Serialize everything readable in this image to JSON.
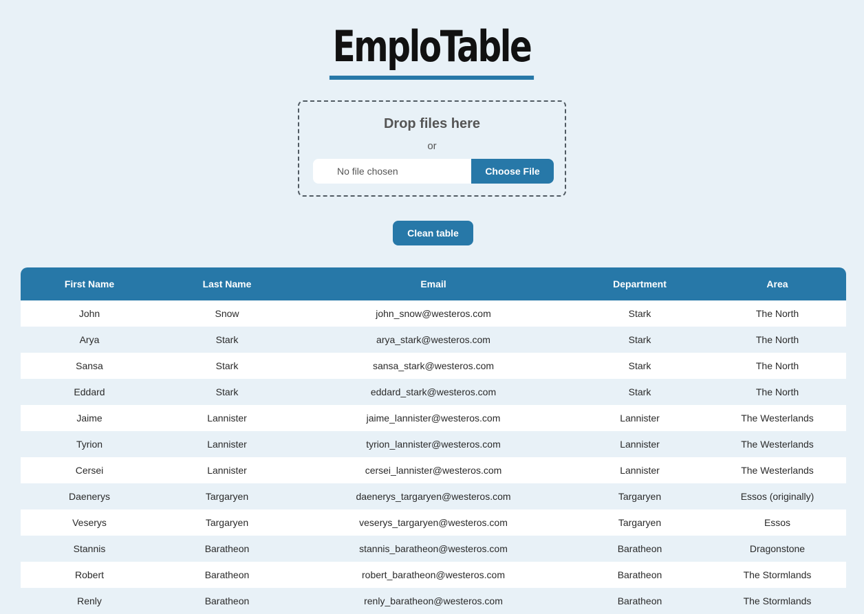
{
  "app": {
    "title": "EmploTable"
  },
  "upload": {
    "drop_title": "Drop files here",
    "or_text": "or",
    "file_status": "No file chosen",
    "choose_label": "Choose File"
  },
  "actions": {
    "clean_label": "Clean table"
  },
  "colors": {
    "accent": "#2778a8",
    "background": "#e8f1f7",
    "row_alt": "#e8f1f7",
    "row": "#ffffff"
  },
  "table": {
    "columns": [
      "First Name",
      "Last Name",
      "Email",
      "Department",
      "Area"
    ],
    "rows": [
      [
        "John",
        "Snow",
        "john_snow@westeros.com",
        "Stark",
        "The North"
      ],
      [
        "Arya",
        "Stark",
        "arya_stark@westeros.com",
        "Stark",
        "The North"
      ],
      [
        "Sansa",
        "Stark",
        "sansa_stark@westeros.com",
        "Stark",
        "The North"
      ],
      [
        "Eddard",
        "Stark",
        "eddard_stark@westeros.com",
        "Stark",
        "The North"
      ],
      [
        "Jaime",
        "Lannister",
        "jaime_lannister@westeros.com",
        "Lannister",
        "The Westerlands"
      ],
      [
        "Tyrion",
        "Lannister",
        "tyrion_lannister@westeros.com",
        "Lannister",
        "The Westerlands"
      ],
      [
        "Cersei",
        "Lannister",
        "cersei_lannister@westeros.com",
        "Lannister",
        "The Westerlands"
      ],
      [
        "Daenerys",
        "Targaryen",
        "daenerys_targaryen@westeros.com",
        "Targaryen",
        "Essos (originally)"
      ],
      [
        "Veserys",
        "Targaryen",
        "veserys_targaryen@westeros.com",
        "Targaryen",
        "Essos"
      ],
      [
        "Stannis",
        "Baratheon",
        "stannis_baratheon@westeros.com",
        "Baratheon",
        "Dragonstone"
      ],
      [
        "Robert",
        "Baratheon",
        "robert_baratheon@westeros.com",
        "Baratheon",
        "The Stormlands"
      ],
      [
        "Renly",
        "Baratheon",
        "renly_baratheon@westeros.com",
        "Baratheon",
        "The Stormlands"
      ]
    ]
  }
}
